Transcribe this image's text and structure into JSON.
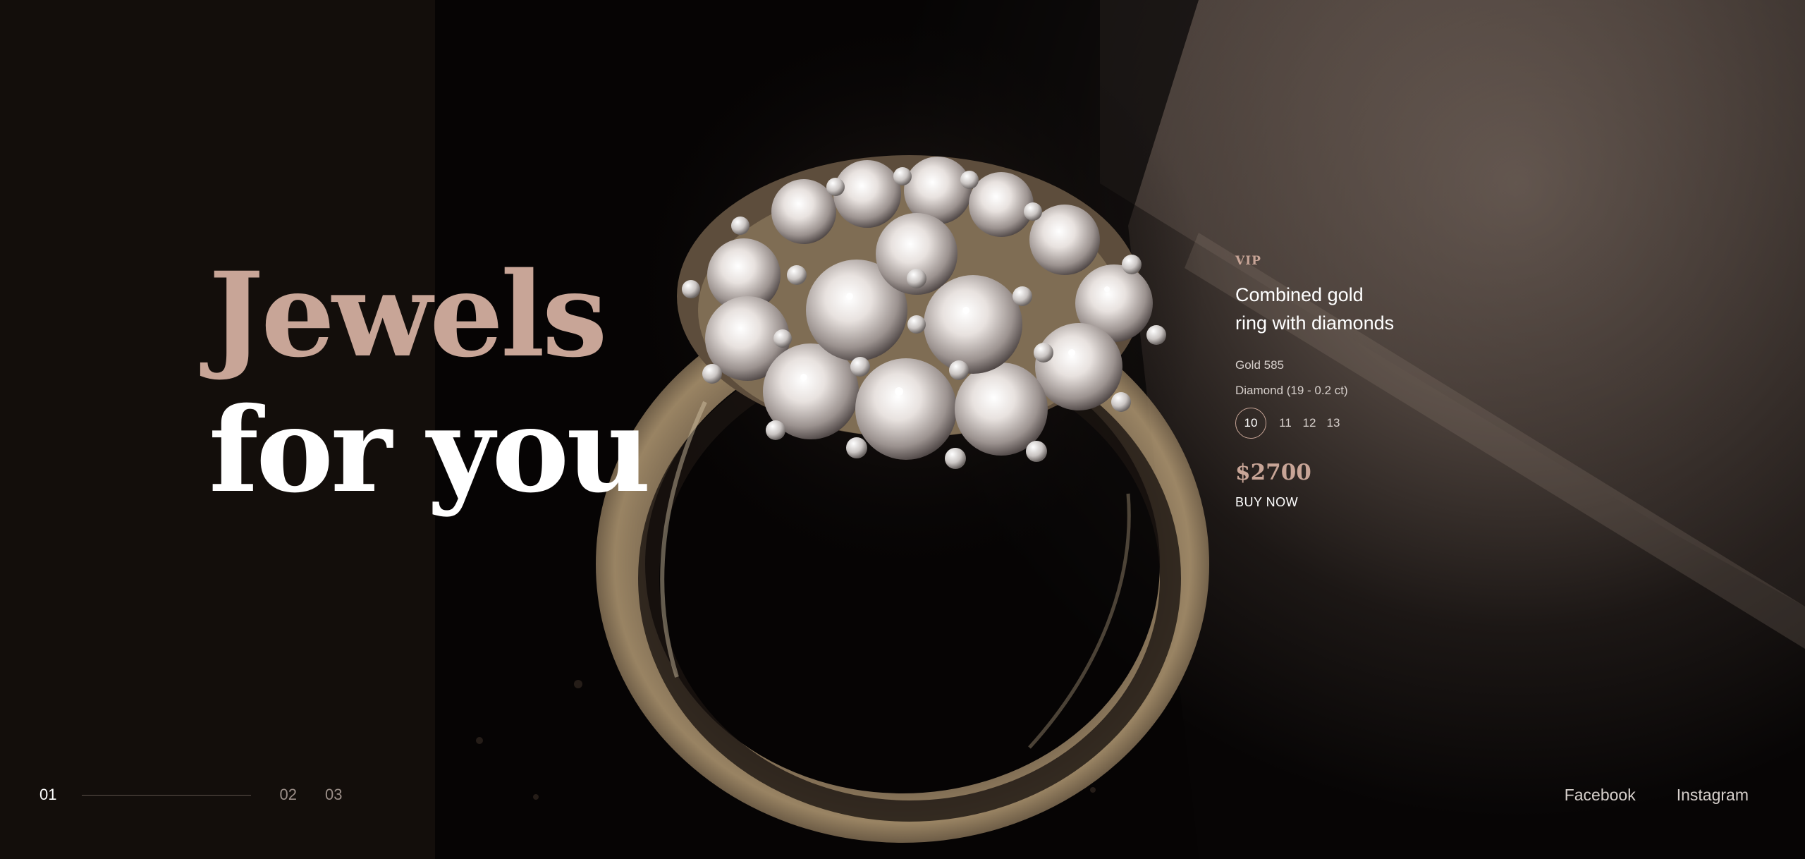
{
  "hero": {
    "line1": "Jewels",
    "line2": "for you"
  },
  "product": {
    "badge": "VIP",
    "name_line1": "Combined gold",
    "name_line2": "ring with diamonds",
    "spec_metal": "Gold 585",
    "spec_stone": "Diamond (19 - 0.2 ct)",
    "sizes": [
      "10",
      "11",
      "12",
      "13"
    ],
    "selected_size": "10",
    "price": "$2700",
    "buy_label": "BUY NOW"
  },
  "pager": {
    "active": "01",
    "slide2": "02",
    "slide3": "03"
  },
  "social": {
    "facebook": "Facebook",
    "instagram": "Instagram"
  },
  "colors": {
    "accent": "#c8a597",
    "panel": "#130e0b",
    "text": "#ffffff"
  }
}
